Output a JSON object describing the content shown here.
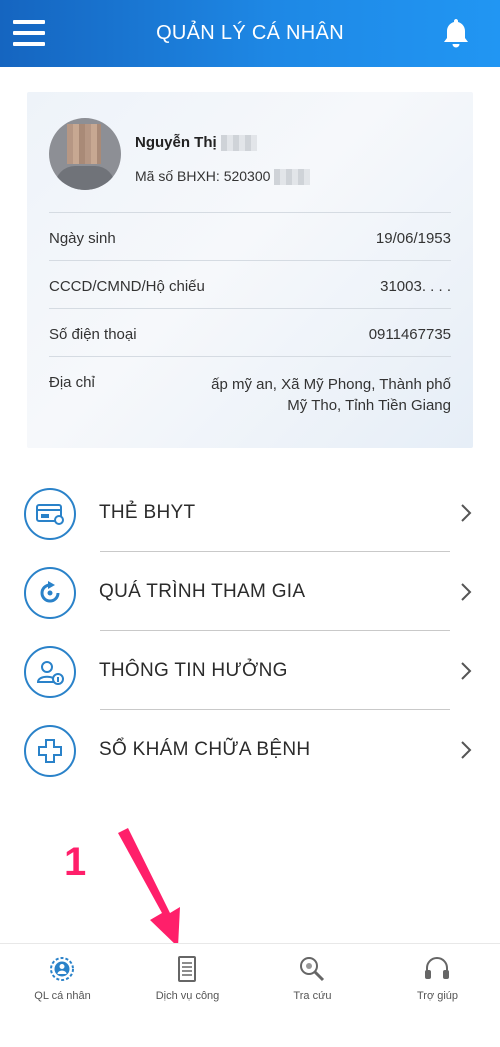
{
  "header": {
    "title": "QUẢN LÝ CÁ NHÂN"
  },
  "profile": {
    "name": "Nguyễn Thị",
    "bhxh_label": "Mã số BHXH: 520300",
    "fields": [
      {
        "label": "Ngày sinh",
        "value": "19/06/1953"
      },
      {
        "label": "CCCD/CMND/Hộ chiếu",
        "value": "31003. . . ."
      },
      {
        "label": "Số điện thoại",
        "value": "0911467735"
      },
      {
        "label": "Địa chỉ",
        "value_line1": "ấp mỹ an, Xã Mỹ Phong, Thành phố",
        "value_line2": "Mỹ Tho, Tỉnh Tiền Giang"
      }
    ]
  },
  "menu": [
    {
      "label": "THẺ BHYT",
      "icon": "card-icon"
    },
    {
      "label": "QUÁ TRÌNH THAM GIA",
      "icon": "history-icon"
    },
    {
      "label": "THÔNG TIN HƯỞNG",
      "icon": "user-info-icon"
    },
    {
      "label": "SỔ KHÁM CHỮA BỆNH",
      "icon": "medical-cross-icon"
    }
  ],
  "annotation": {
    "number": "1"
  },
  "bottom_nav": [
    {
      "label": "QL cá nhân",
      "icon": "personal-icon"
    },
    {
      "label": "Dịch vụ công",
      "icon": "document-icon"
    },
    {
      "label": "Tra cứu",
      "icon": "search-icon"
    },
    {
      "label": "Trợ giúp",
      "icon": "headset-icon"
    }
  ],
  "colors": {
    "header": "#1e88e5",
    "icon_blue": "#2a82c9",
    "annotation": "#ff1f6a"
  }
}
